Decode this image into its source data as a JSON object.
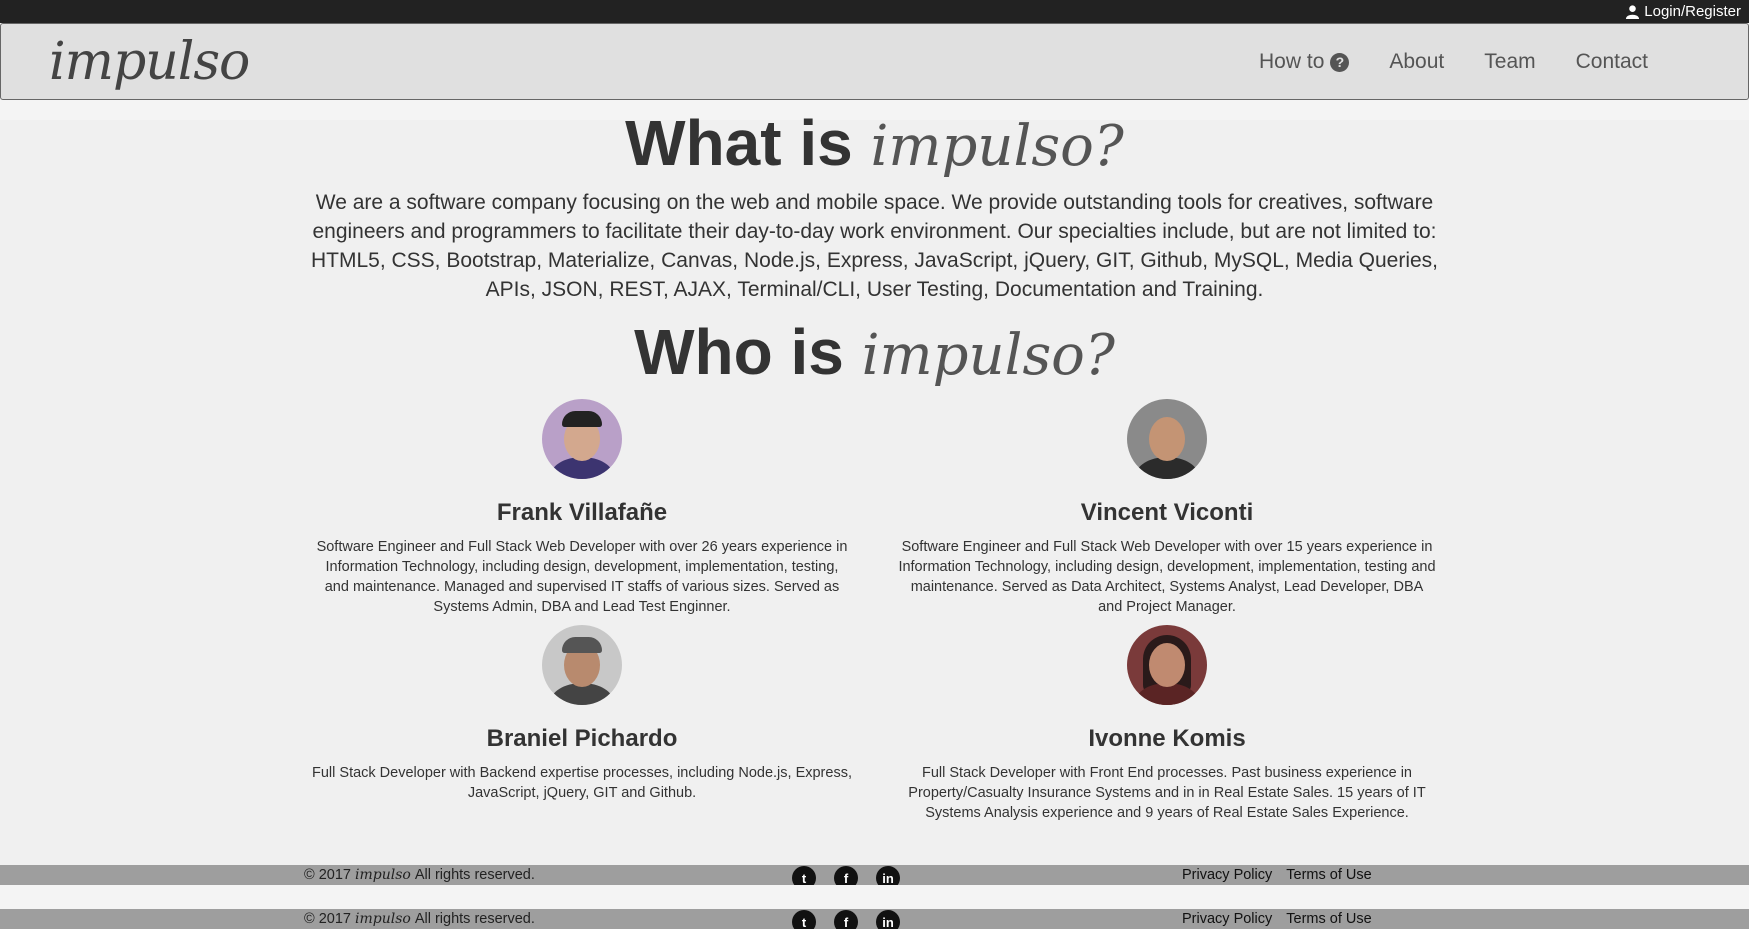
{
  "topbar": {
    "login_label": "Login/Register"
  },
  "navbar": {
    "brand": "impulso",
    "links": [
      {
        "label": "How to",
        "icon": "question-circle-icon"
      },
      {
        "label": "About"
      },
      {
        "label": "Team"
      },
      {
        "label": "Contact"
      }
    ]
  },
  "what": {
    "title_prefix": "What is",
    "title_script": "impulso?",
    "body": "We are a software company focusing on the web and mobile space. We provide outstanding tools for creatives, software engineers and programmers to facilitate their day-to-day work environment. Our specialties include, but are not limited to: HTML5, CSS, Bootstrap, Materialize, Canvas, Node.js, Express, JavaScript, jQuery, GIT, Github, MySQL, Media Queries, APIs, JSON, REST, AJAX, Terminal/CLI, User Testing, Documentation and Training."
  },
  "who": {
    "title_prefix": "Who is",
    "title_script": "impulso?",
    "members": [
      {
        "name": "Frank Villafañe",
        "bio": "Software Engineer and Full Stack Web Developer with over 26 years experience in Information Technology, including design, development, implementation, testing, and maintenance. Managed and supervised IT staffs of various sizes. Served as Systems Admin, DBA and Lead Test Enginner."
      },
      {
        "name": "Vincent Viconti",
        "bio": "Software Engineer and Full Stack Web Developer with over 15 years experience in Information Technology, including design, development, implementation, testing and maintenance. Served as Data Architect, Systems Analyst, Lead Developer, DBA and Project Manager."
      },
      {
        "name": "Braniel Pichardo",
        "bio": "Full Stack Developer with Backend expertise processes, including Node.js, Express, JavaScript, jQuery, GIT and Github."
      },
      {
        "name": "Ivonne Komis",
        "bio": "Full Stack Developer with Front End processes. Past business experience in Property/Casualty Insurance Systems and in in Real Estate Sales. 15 years of IT Systems Analysis experience and 9 years of Real Estate Sales Experience."
      }
    ]
  },
  "footer": {
    "copyright_prefix": "© 2017",
    "copyright_brand": "impulso",
    "copyright_suffix": "All rights reserved.",
    "social": [
      "twitter-icon",
      "facebook-icon",
      "linkedin-icon"
    ],
    "privacy": "Privacy Policy",
    "terms": "Terms of Use"
  },
  "colors": {
    "topbar": "#222222",
    "navbar": "#e0e0e0",
    "page": "#f0f0f0",
    "footer": "#9e9e9e"
  }
}
